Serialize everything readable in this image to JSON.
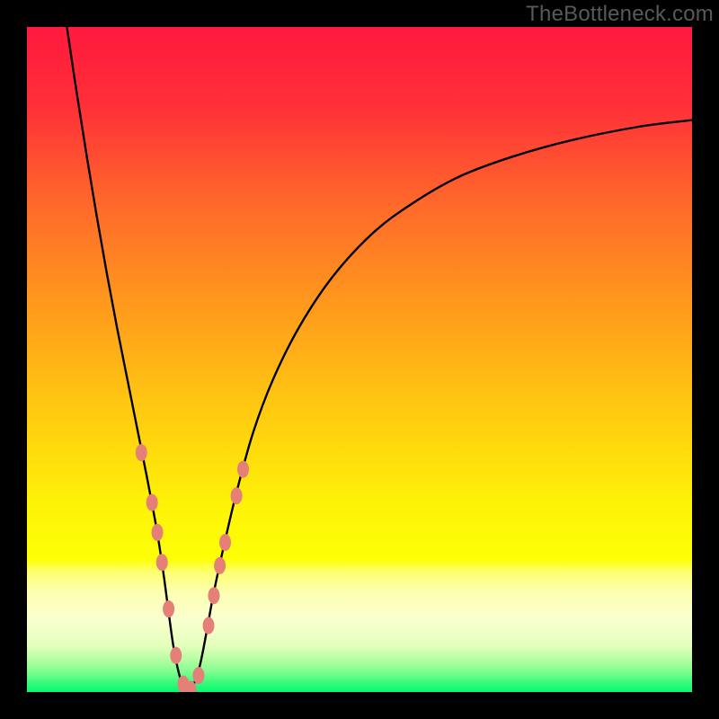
{
  "watermark": "TheBottleneck.com",
  "chart_data": {
    "type": "line",
    "title": "",
    "xlabel": "",
    "ylabel": "",
    "xlim": [
      0,
      100
    ],
    "ylim": [
      0,
      100
    ],
    "background_gradient_stops": [
      {
        "offset": 0.0,
        "color": "#ff193e"
      },
      {
        "offset": 0.12,
        "color": "#ff3038"
      },
      {
        "offset": 0.27,
        "color": "#ff6a2a"
      },
      {
        "offset": 0.42,
        "color": "#ff9a1c"
      },
      {
        "offset": 0.57,
        "color": "#ffc811"
      },
      {
        "offset": 0.72,
        "color": "#fef307"
      },
      {
        "offset": 0.8,
        "color": "#feff06"
      },
      {
        "offset": 0.82,
        "color": "#feff72"
      },
      {
        "offset": 0.85,
        "color": "#fdffb1"
      },
      {
        "offset": 0.89,
        "color": "#fbffce"
      },
      {
        "offset": 0.93,
        "color": "#e4ffbd"
      },
      {
        "offset": 0.95,
        "color": "#b8fea4"
      },
      {
        "offset": 0.97,
        "color": "#7efd8e"
      },
      {
        "offset": 0.985,
        "color": "#3bfb7d"
      },
      {
        "offset": 1.0,
        "color": "#04fa6f"
      }
    ],
    "series": [
      {
        "name": "bottleneck-curve",
        "stroke": "#000000",
        "stroke_width": 2.4,
        "x": [
          6.0,
          7.5,
          9.0,
          10.5,
          12.0,
          13.5,
          15.0,
          16.5,
          18.0,
          19.5,
          20.5,
          21.3,
          22.0,
          22.8,
          23.5,
          24.3,
          25.0,
          26.0,
          27.0,
          28.0,
          29.5,
          31.5,
          34.0,
          37.0,
          41.0,
          46.0,
          52.0,
          58.0,
          65.0,
          73.0,
          82.0,
          92.0,
          100.0
        ],
        "y": [
          100.0,
          90.0,
          80.5,
          71.5,
          63.0,
          55.0,
          47.5,
          40.0,
          32.5,
          24.5,
          18.0,
          12.0,
          7.0,
          3.0,
          1.0,
          0.3,
          1.0,
          4.0,
          9.0,
          14.5,
          21.5,
          30.0,
          39.0,
          47.0,
          55.0,
          62.5,
          69.0,
          73.5,
          77.5,
          80.5,
          83.0,
          85.0,
          86.0
        ]
      }
    ],
    "markers": {
      "color": "#e58078",
      "rx": 6.5,
      "ry": 9.5,
      "points_xy": [
        [
          17.2,
          36.0
        ],
        [
          18.8,
          28.5
        ],
        [
          19.6,
          24.0
        ],
        [
          20.3,
          19.5
        ],
        [
          21.3,
          12.5
        ],
        [
          22.4,
          5.5
        ],
        [
          23.5,
          1.2
        ],
        [
          24.6,
          0.4
        ],
        [
          25.8,
          2.5
        ],
        [
          27.3,
          10.0
        ],
        [
          28.1,
          14.5
        ],
        [
          29.0,
          19.0
        ],
        [
          29.8,
          22.5
        ],
        [
          31.5,
          29.5
        ],
        [
          32.5,
          33.5
        ]
      ]
    }
  }
}
